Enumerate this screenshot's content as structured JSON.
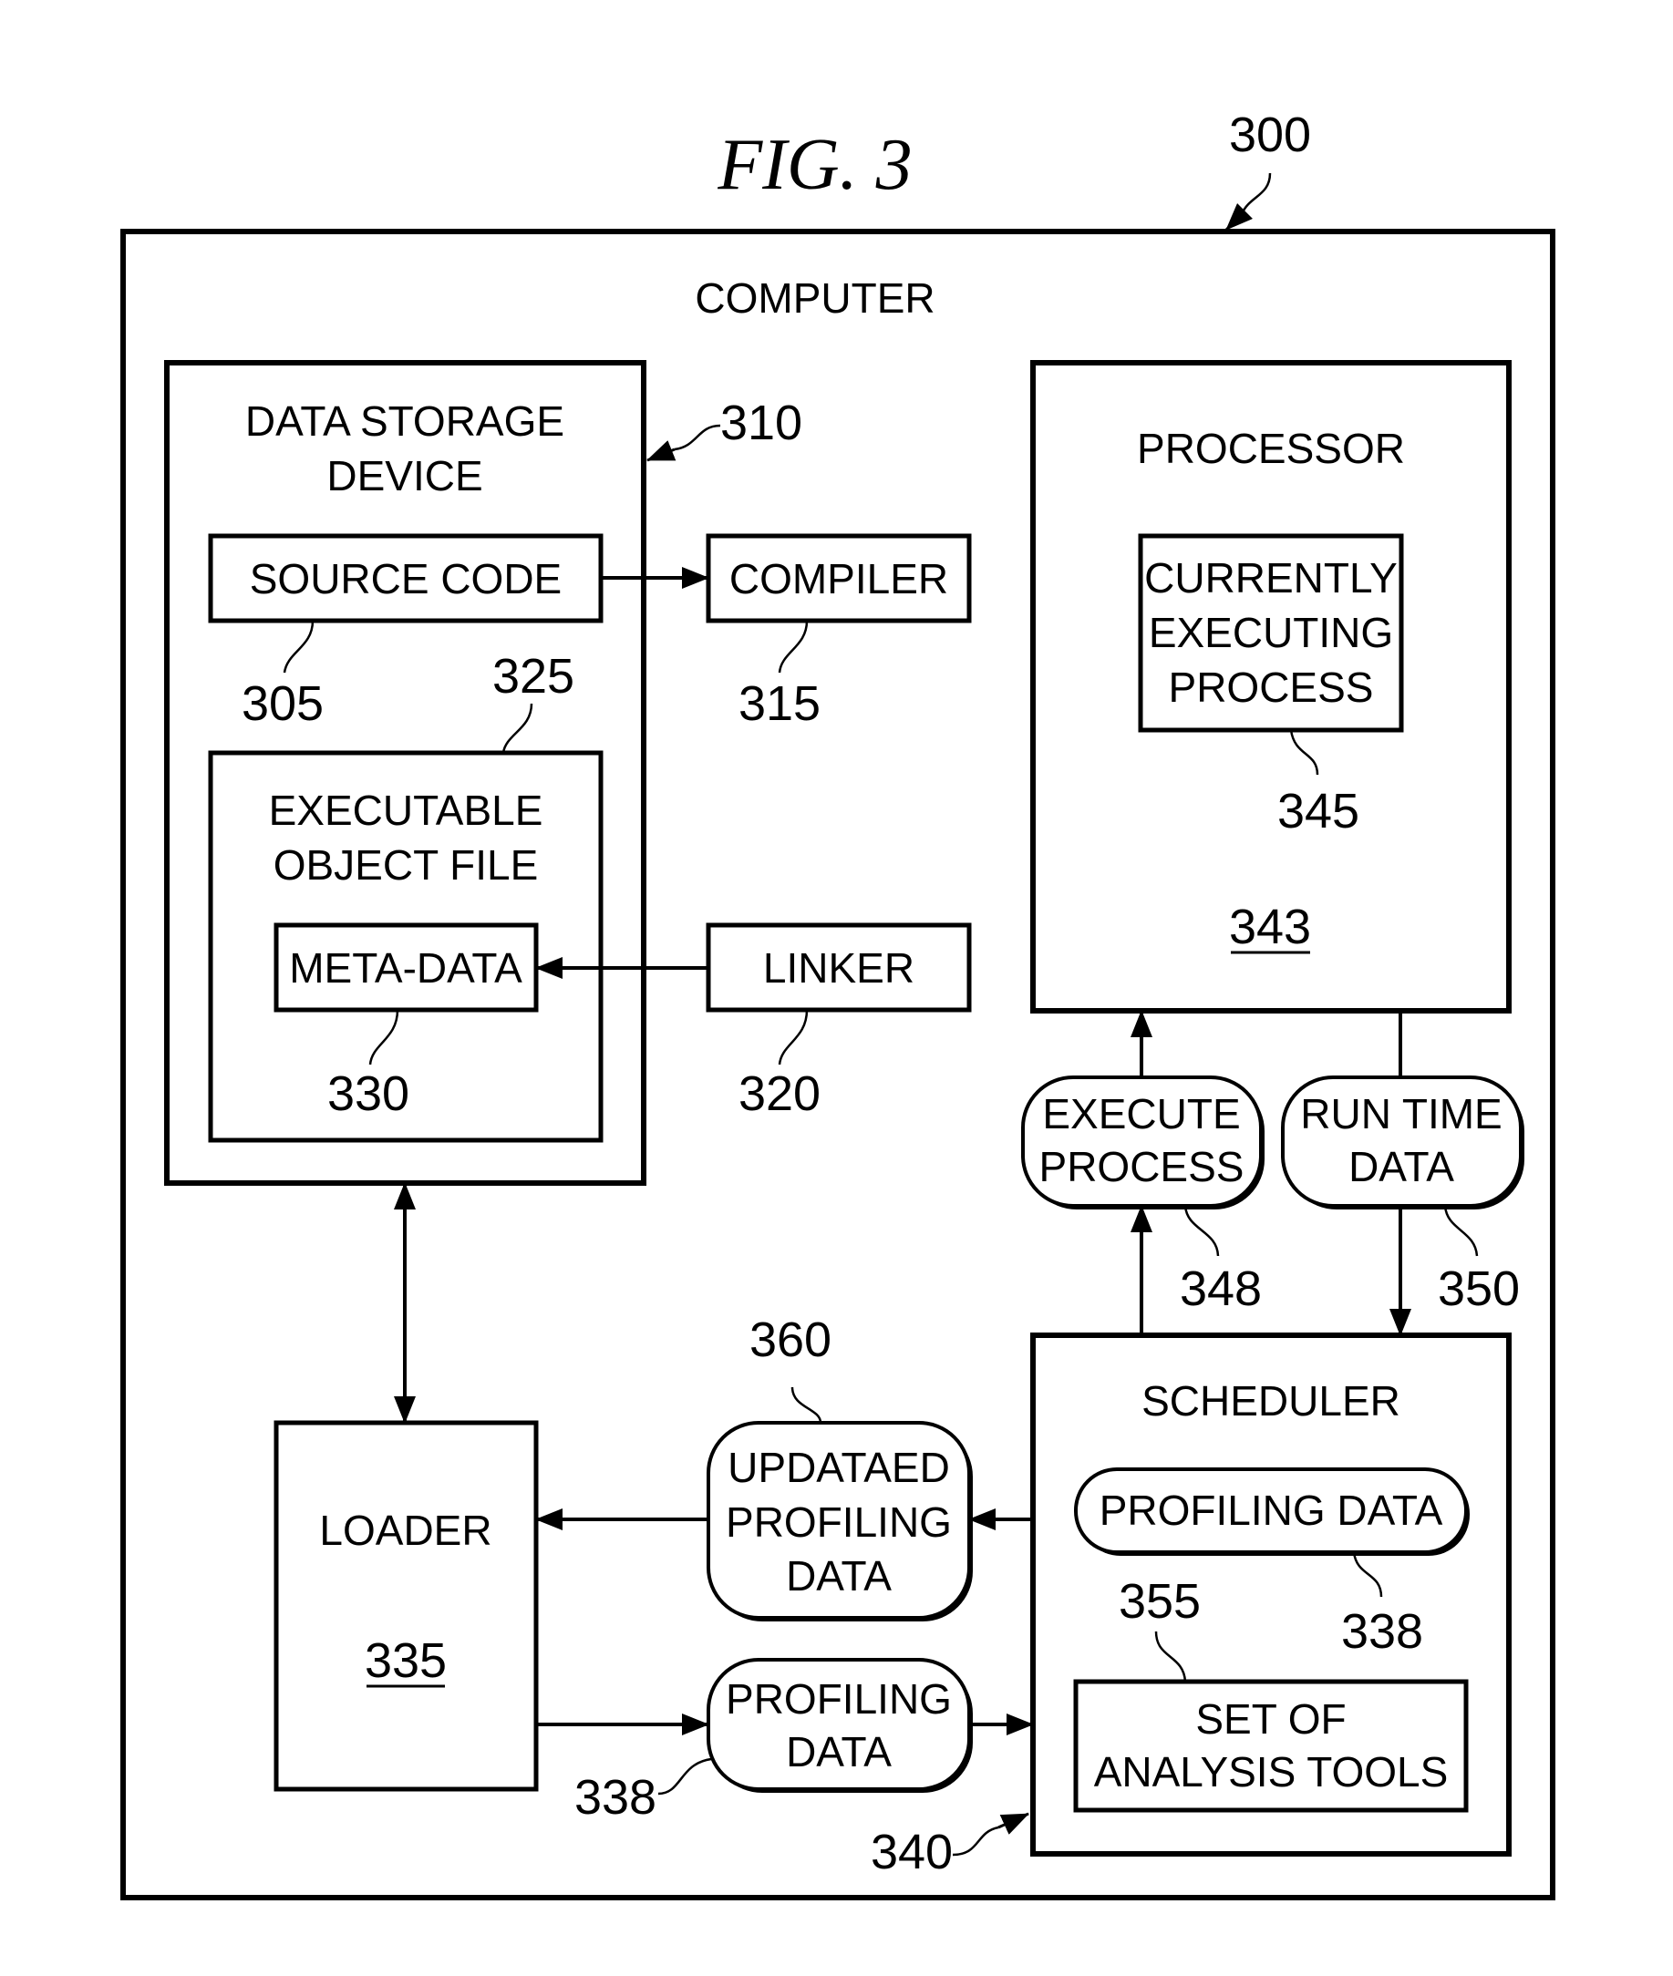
{
  "figure": {
    "title": "FIG. 3",
    "ref": "300",
    "container_label": "COMPUTER"
  },
  "nodes": {
    "data_storage": {
      "line1": "DATA STORAGE",
      "line2": "DEVICE",
      "ref": "310"
    },
    "source_code": {
      "label": "SOURCE CODE",
      "ref": "305"
    },
    "compiler": {
      "label": "COMPILER",
      "ref": "315"
    },
    "executable_object_file": {
      "line1": "EXECUTABLE",
      "line2": "OBJECT FILE",
      "ref": "325"
    },
    "meta_data": {
      "label": "META-DATA",
      "ref": "330"
    },
    "linker": {
      "label": "LINKER",
      "ref": "320"
    },
    "processor": {
      "label": "PROCESSOR",
      "ref": "343"
    },
    "currently_executing_process": {
      "line1": "CURRENTLY",
      "line2": "EXECUTING",
      "line3": "PROCESS",
      "ref": "345"
    },
    "execute_process": {
      "line1": "EXECUTE",
      "line2": "PROCESS",
      "ref": "348"
    },
    "run_time_data": {
      "line1": "RUN TIME",
      "line2": "DATA",
      "ref": "350"
    },
    "scheduler": {
      "label": "SCHEDULER",
      "ref": "340"
    },
    "scheduler_profiling_data": {
      "label": "PROFILING DATA",
      "ref": "338"
    },
    "analysis_tools": {
      "line1": "SET OF",
      "line2": "ANALYSIS TOOLS",
      "ref": "355"
    },
    "loader": {
      "label": "LOADER",
      "ref": "335"
    },
    "updated_profiling_data": {
      "line1": "UPDATAED",
      "line2": "PROFILING",
      "line3": "DATA",
      "ref": "360"
    },
    "profiling_data": {
      "line1": "PROFILING",
      "line2": "DATA",
      "ref": "338"
    }
  }
}
